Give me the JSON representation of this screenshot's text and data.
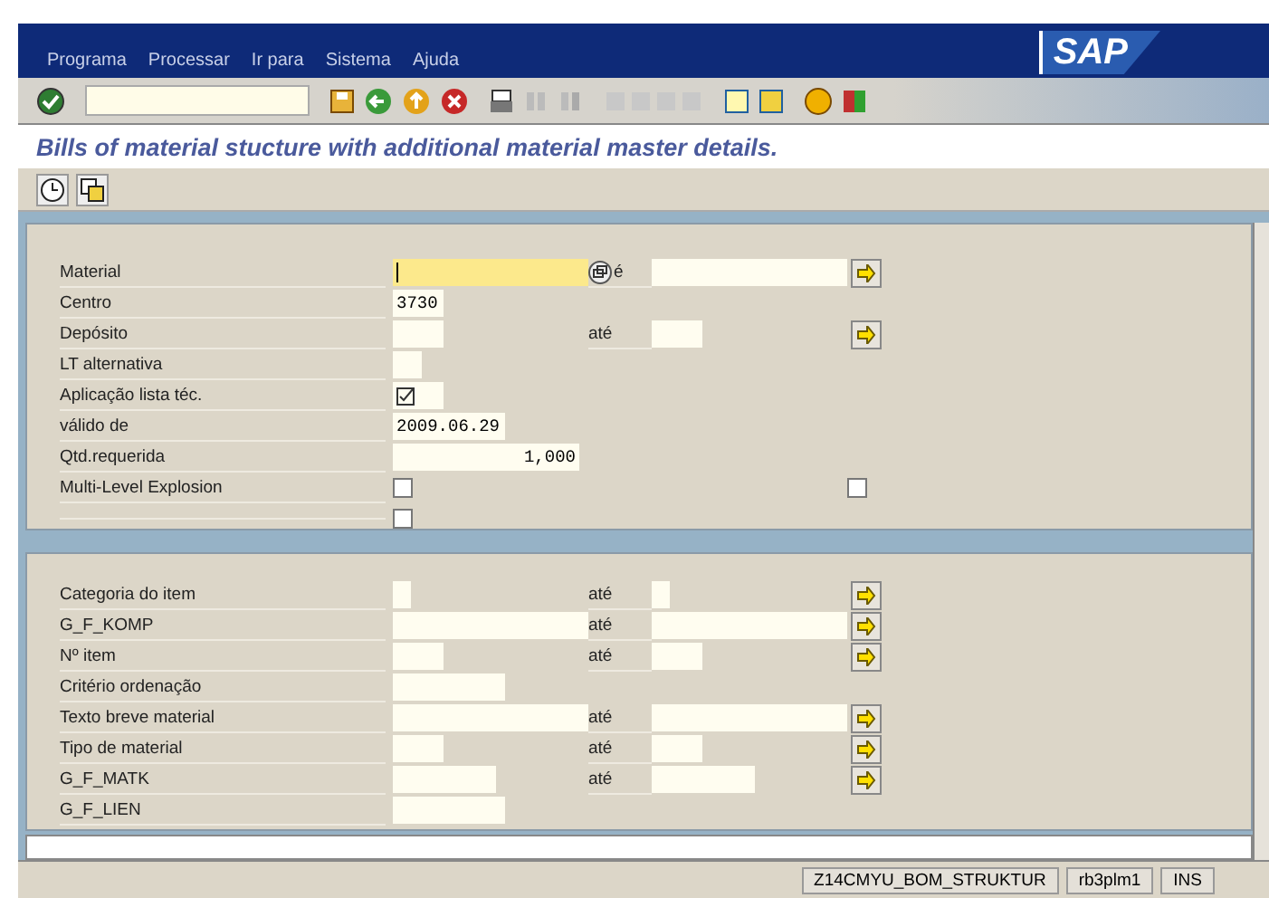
{
  "logo": "SAP",
  "menu": [
    "Programa",
    "Processar",
    "Ir para",
    "Sistema",
    "Ajuda"
  ],
  "title": "Bills of material stucture with additional material master details.",
  "upper_rows": [
    {
      "label": "Material",
      "kind": "range",
      "value": "",
      "focused": true,
      "to_label": "é"
    },
    {
      "label": "Centro",
      "kind": "single",
      "value": "3730",
      "focused": false
    },
    {
      "label": "Depósito",
      "kind": "range",
      "value": "",
      "focused": false,
      "to_label": "até"
    },
    {
      "label": "LT alternativa",
      "kind": "single",
      "value": "",
      "focused": false
    },
    {
      "label": "Aplicação lista téc.",
      "kind": "flag",
      "checked": true
    },
    {
      "label": "válido de",
      "kind": "single",
      "value": "2009.06.29",
      "focused": false
    },
    {
      "label": "Qtd.requerida",
      "kind": "number",
      "value": "1,000",
      "focused": false
    },
    {
      "label": "Multi-Level Explosion",
      "kind": "checkbox",
      "boxes": [
        {
          "checked": false
        },
        {
          "checked": false
        }
      ]
    },
    {
      "kind": "checkbox",
      "boxes": [
        {
          "checked": false
        }
      ]
    }
  ],
  "lower_rows": [
    {
      "label": "Categoria do item",
      "kind": "range",
      "value": "",
      "focused": false,
      "to_label": "até"
    },
    {
      "label": "G_F_KOMP",
      "kind": "range",
      "value": "",
      "focused": false,
      "to_label": "até"
    },
    {
      "label": "Nº item",
      "kind": "range",
      "value": "",
      "focused": false,
      "to_label": "até"
    },
    {
      "label": "Critério ordenação",
      "kind": "single",
      "value": "",
      "focused": false
    },
    {
      "label": "Texto breve material",
      "kind": "range",
      "value": "",
      "focused": false,
      "to_label": "até"
    },
    {
      "label": "Tipo de material",
      "kind": "range",
      "value": "",
      "focused": false,
      "to_label": "até"
    },
    {
      "label": "G_F_MATK",
      "kind": "range",
      "value": "",
      "focused": false,
      "to_label": "até"
    },
    {
      "label": "G_F_LIEN",
      "kind": "single",
      "value": "",
      "focused": false
    }
  ],
  "status_bar": {
    "program": "Z14CMYU_BOM_STRUKTUR",
    "server": "rb3plm1",
    "mode": "INS"
  }
}
